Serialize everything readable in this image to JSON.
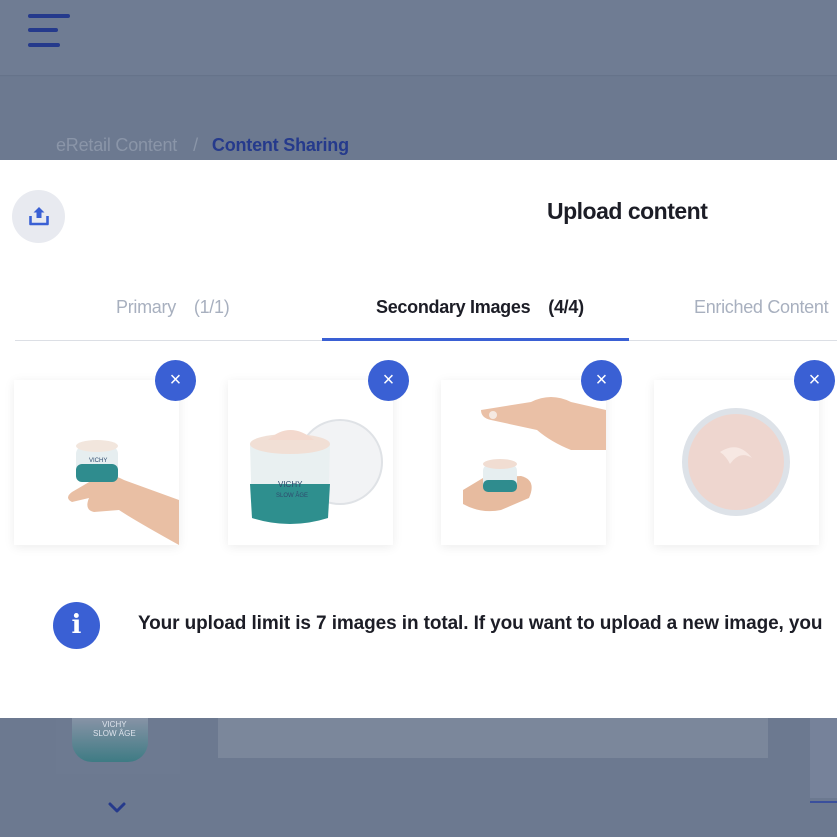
{
  "header": {
    "menu_icon": "hamburger-menu-icon"
  },
  "breadcrumb": {
    "parent": "eRetail Content",
    "separator": "/",
    "current": "Content Sharing"
  },
  "background": {
    "jar_brand": "VICHY",
    "jar_line": "SLOW ÂGE"
  },
  "modal": {
    "icon": "upload-icon",
    "title": "Upload content",
    "tabs": [
      {
        "label": "Primary",
        "count": "(1/1)",
        "active": false
      },
      {
        "label": "Secondary Images",
        "count": "(4/4)",
        "active": true
      },
      {
        "label": "Enriched Content",
        "count": "",
        "active": false
      }
    ],
    "images": [
      {
        "alt": "hand holding jar",
        "remove_label": "×"
      },
      {
        "alt": "open jar with lid",
        "remove_label": "×"
      },
      {
        "alt": "hands applying cream",
        "remove_label": "×"
      },
      {
        "alt": "cream texture",
        "remove_label": "×"
      }
    ],
    "info": {
      "icon": "info-icon",
      "glyph": "i",
      "text": "Your upload limit is 7 images in total. If you want to upload a new image, you"
    }
  },
  "colors": {
    "accent": "#3a60d4",
    "brand_dark": "#253a8c"
  }
}
